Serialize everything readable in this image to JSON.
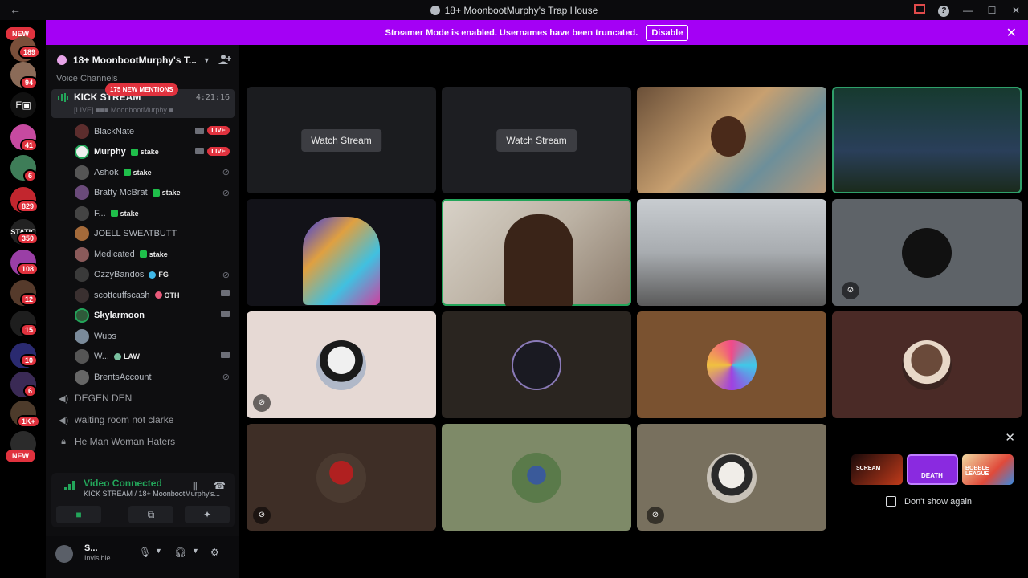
{
  "titlebar": {
    "title": "18+ MoonbootMurphy's Trap House"
  },
  "guilds": {
    "new_top": "NEW",
    "new_bottom": "NEW",
    "badges": [
      "189",
      "94",
      "41",
      "6",
      "829",
      "350",
      "108",
      "12",
      "15",
      "10",
      "6",
      "1K+"
    ]
  },
  "banner": {
    "text": "Streamer Mode is enabled. Usernames have been truncated.",
    "disable_label": "Disable"
  },
  "server": {
    "name": "18+ MoonbootMurphy's T...",
    "category": "Voice Channels",
    "mentions": "175 NEW MENTIONS",
    "active_channel": {
      "name": "KICK STREAM",
      "time": "4:21:16",
      "topic": "[LIVE] ■■■ MoonbootMurphy ■"
    },
    "users": [
      {
        "name": "BlackNate",
        "tag": "",
        "live": "LIVE",
        "bold": false
      },
      {
        "name": "Murphy",
        "tag": "stake",
        "live": "LIVE",
        "bold": true
      },
      {
        "name": "Ashok",
        "tag": "stake",
        "live": "",
        "bold": false
      },
      {
        "name": "Bratty McBrat",
        "tag": "stake",
        "live": "",
        "bold": false
      },
      {
        "name": "F...",
        "tag": "stake",
        "live": "",
        "bold": false
      },
      {
        "name": "JOELL SWEATBUTT",
        "tag": "",
        "live": "",
        "bold": false
      },
      {
        "name": "Medicated",
        "tag": "stake",
        "live": "",
        "bold": false
      },
      {
        "name": "OzzyBandos",
        "tag": "FG",
        "live": "",
        "bold": false
      },
      {
        "name": "scottcuffscash",
        "tag": "OTH",
        "live": "",
        "bold": false
      },
      {
        "name": "Skylarmoon",
        "tag": "",
        "live": "",
        "bold": true
      },
      {
        "name": "Wubs",
        "tag": "",
        "live": "",
        "bold": false
      },
      {
        "name": "W...",
        "tag": "LAW",
        "live": "",
        "bold": false
      },
      {
        "name": "BrentsAccount",
        "tag": "",
        "live": "",
        "bold": false
      }
    ],
    "channels": [
      {
        "name": "DEGEN DEN",
        "icon": "speaker-icon"
      },
      {
        "name": "waiting room not clarke",
        "icon": "speaker-icon"
      },
      {
        "name": "He Man Woman Haters",
        "icon": "lock-icon"
      }
    ]
  },
  "voice": {
    "status": "Video Connected",
    "channel": "KICK STREAM / 18+ MoonbootMurphy's..."
  },
  "user": {
    "name": "S...",
    "status": "Invisible"
  },
  "grid": {
    "watch_label": "Watch Stream"
  },
  "activity": {
    "dont_show": "Don't show again",
    "cards": [
      "SCREAM",
      "DEATH",
      "BOBBLE LEAGUE"
    ]
  },
  "colors": {
    "banner": "#a400f5",
    "live": "#e0323e",
    "connected": "#23a55a",
    "speaking": "#23a55a"
  }
}
